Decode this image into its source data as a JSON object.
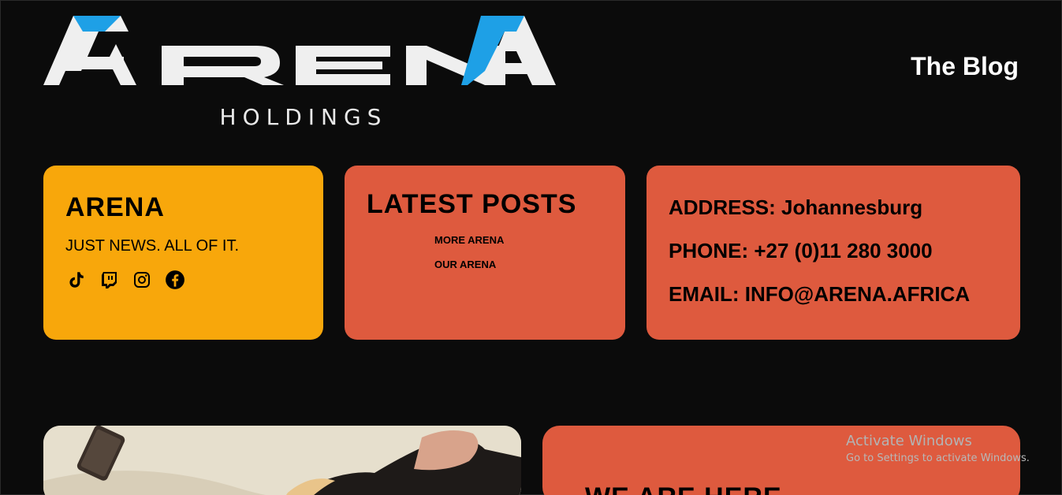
{
  "header": {
    "logo_text": "ARENA",
    "logo_subtext": "HOLDINGS",
    "nav_blog": "The Blog",
    "logo_colors": {
      "white": "#efefef",
      "blue": "#1ea0e6"
    }
  },
  "cards": {
    "arena": {
      "title": "ARENA",
      "tagline": "JUST NEWS. ALL OF IT.",
      "social_icons": [
        "tiktok-icon",
        "twitch-icon",
        "instagram-icon",
        "facebook-icon"
      ],
      "bg": "#f8a70b"
    },
    "posts": {
      "title": "LATEST POSTS",
      "items": [
        "MORE ARENA",
        "OUR ARENA"
      ],
      "bg": "#de5a3e"
    },
    "contact": {
      "address": "ADDRESS: Johannesburg",
      "phone": "PHONE: +27 (0)11 280 3000",
      "email": "EMAIL: INFO@ARENA.AFRICA"
    }
  },
  "bottom": {
    "here_title": "WE ARE HERE"
  },
  "watermark": {
    "line1": "Activate Windows",
    "line2": "Go to Settings to activate Windows."
  }
}
